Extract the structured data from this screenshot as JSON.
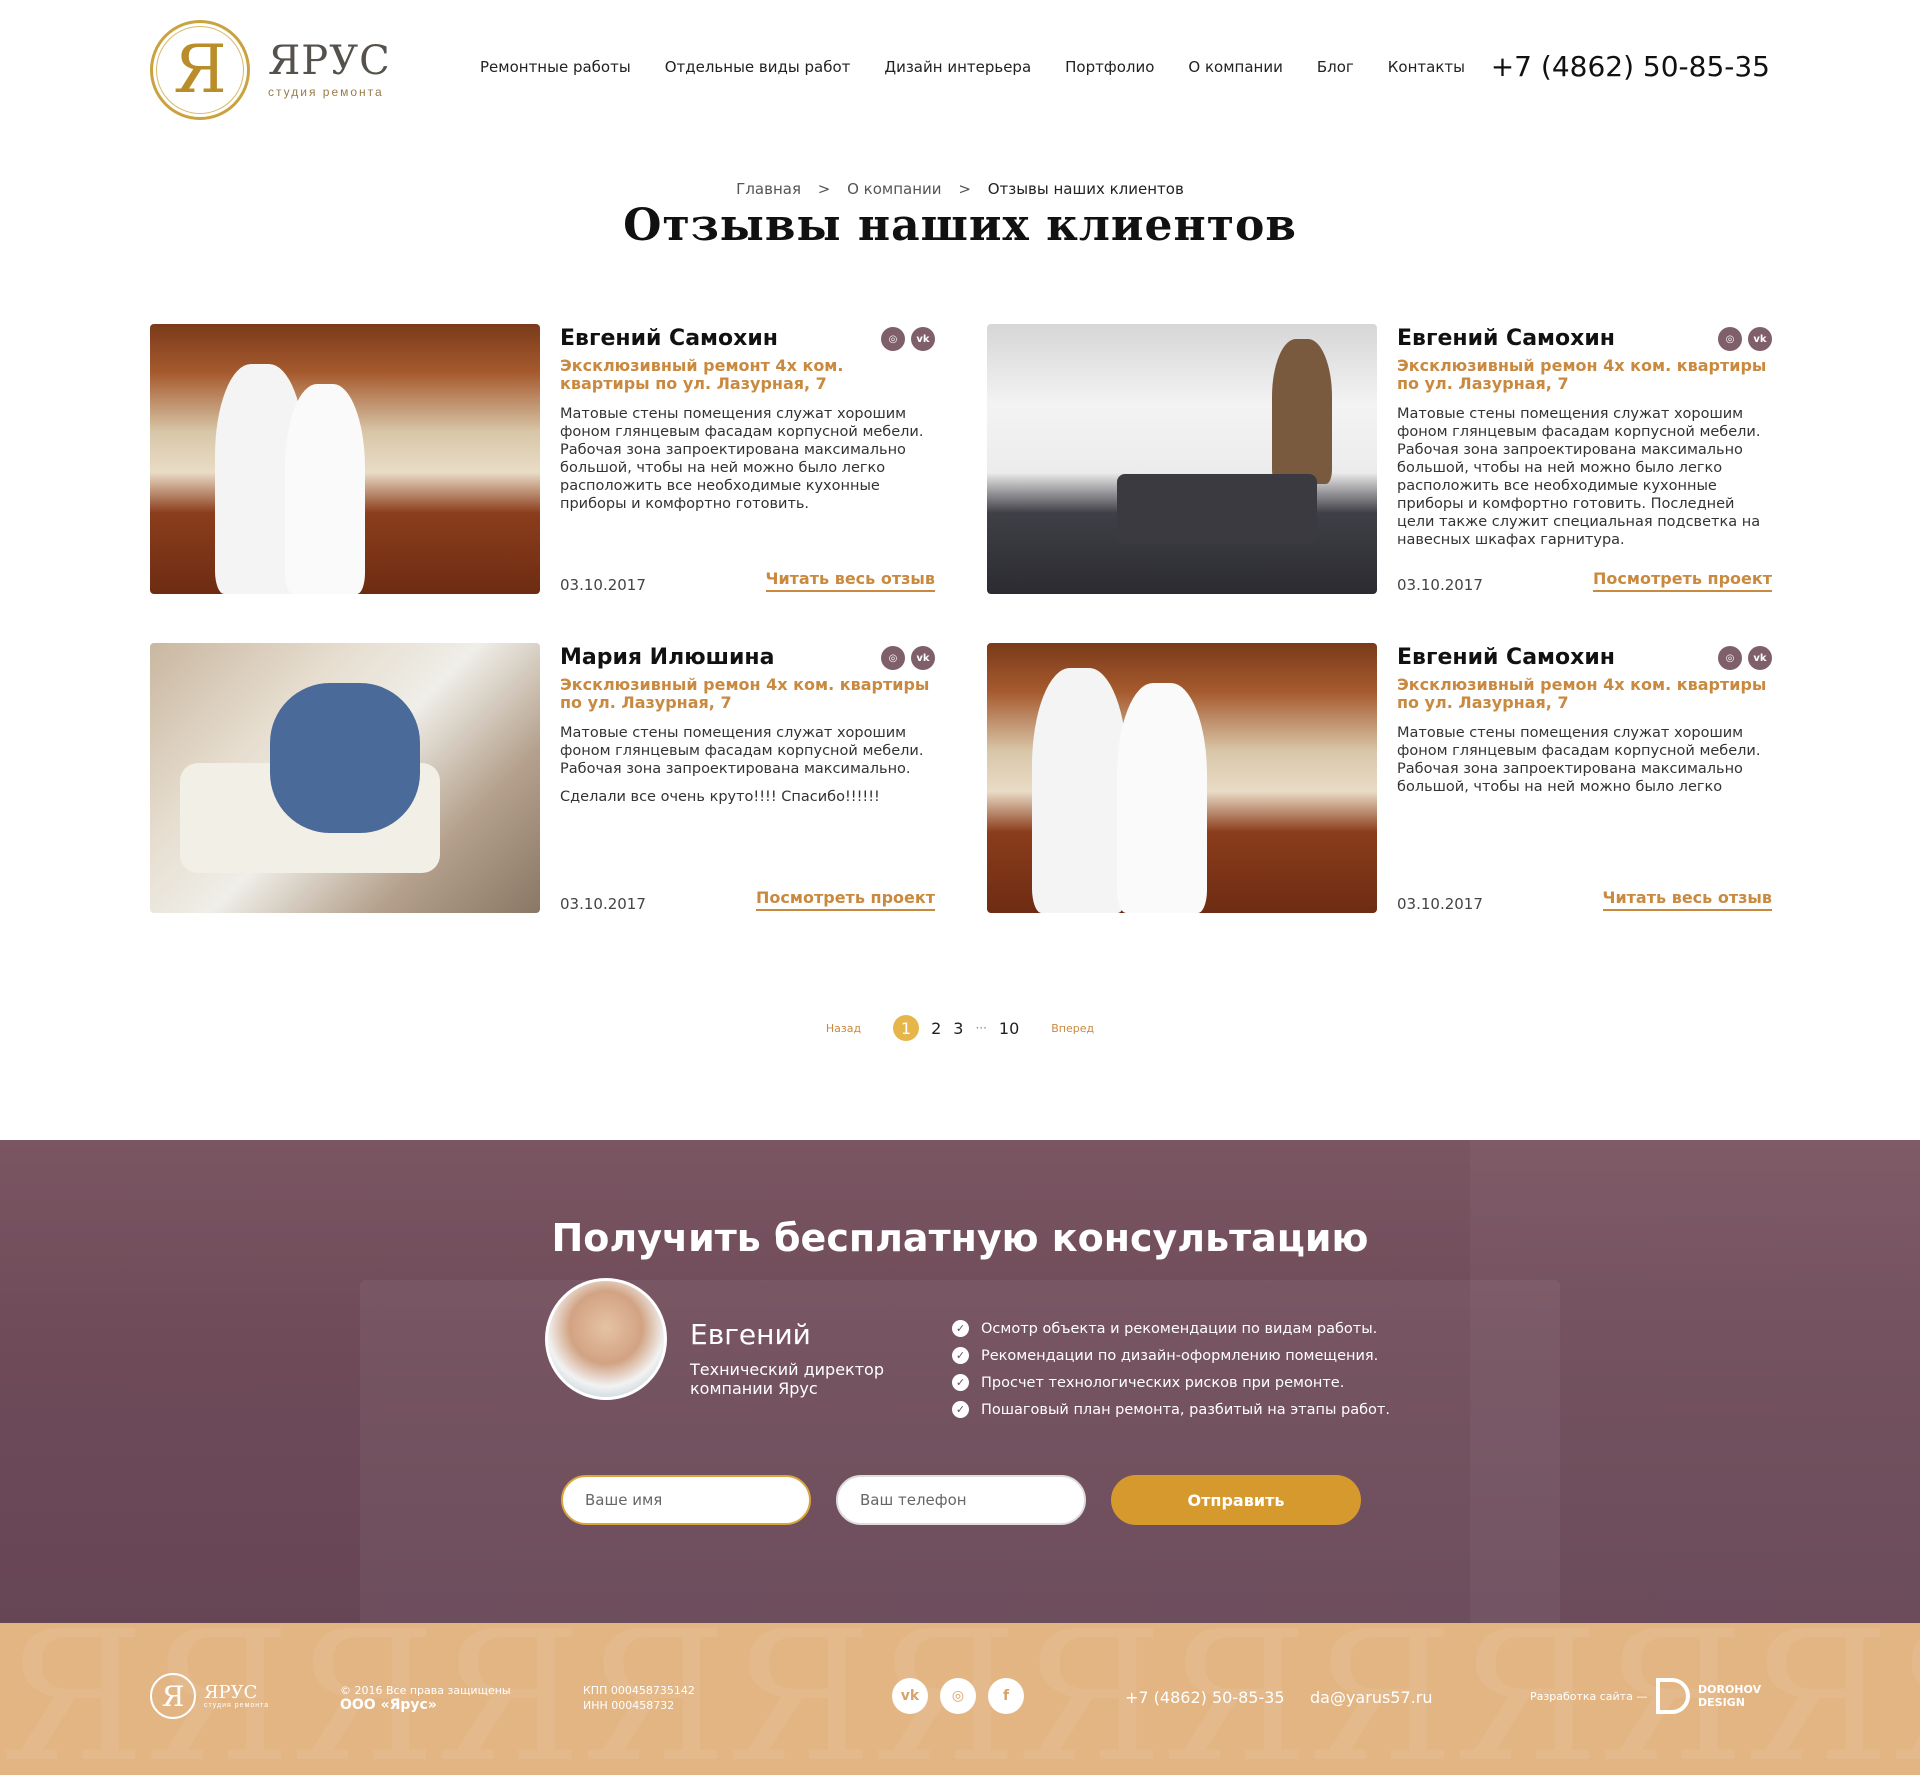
{
  "header": {
    "logo_name": "ЯРУС",
    "logo_sub": "студия ремонта",
    "nav": [
      "Ремонтные работы",
      "Отдельные виды работ",
      "Дизайн интерьера",
      "Портфолио",
      "О компании",
      "Блог",
      "Контакты"
    ],
    "phone": "+7 (4862) 50-85-35"
  },
  "breadcrumb": {
    "items": [
      "Главная",
      "О компании",
      "Отзывы наших клиентов"
    ],
    "separator": ">"
  },
  "page_title": "Отзывы наших клиентов",
  "reviews": [
    {
      "name": "Евгений Самохин",
      "project": "Эксклюзивный ремонт 4х ком. квартиры по ул. Лазурная, 7",
      "text": "Матовые стены помещения служат хорошим фоном глянцевым фасадам корпусной мебели. Рабочая зона запроектирована максимально большой, чтобы на ней можно было легко расположить все необходимые кухонные приборы и комфортно готовить.",
      "extra": "",
      "date": "03.10.2017",
      "link": "Читать весь отзыв",
      "photo": "kitchen"
    },
    {
      "name": "Евгений Самохин",
      "project": "Эксклюзивный ремон 4х ком. квартиры по ул. Лазурная, 7",
      "text": "Матовые стены помещения служат хорошим фоном глянцевым фасадам корпусной мебели. Рабочая зона запроектирована максимально большой, чтобы на ней можно было легко расположить все необходимые кухонные приборы и комфортно готовить. Последней цели также служит специальная подсветка на навесных шкафах гарнитура.",
      "extra": "",
      "date": "03.10.2017",
      "link": "Посмотреть проект",
      "photo": "living"
    },
    {
      "name": "Мария Илюшина",
      "project": "Эксклюзивный ремон 4х ком. квартиры по ул. Лазурная, 7",
      "text": "Матовые стены помещения служат хорошим фоном глянцевым фасадам корпусной мебели. Рабочая зона запроектирована максимально.",
      "extra": "Сделали все очень круто!!!! Спасибо!!!!!!",
      "date": "03.10.2017",
      "link": "Посмотреть проект",
      "photo": "sofa"
    },
    {
      "name": "Евгений Самохин",
      "project": "Эксклюзивный ремон 4х ком. квартиры по ул. Лазурная, 7",
      "text": "Матовые стены помещения служат хорошим фоном глянцевым фасадам корпусной мебели. Рабочая зона запроектирована максимально большой, чтобы на ней можно было легко",
      "extra": "",
      "date": "03.10.2017",
      "link": "Читать весь отзыв",
      "photo": "kitchen"
    }
  ],
  "review_socials": [
    "instagram-icon",
    "vk-icon"
  ],
  "pagination": {
    "prev": "Назад",
    "next": "Вперед",
    "pages": [
      "1",
      "2",
      "3"
    ],
    "dots": "···",
    "last": "10",
    "current": "1"
  },
  "consult": {
    "title": "Получить бесплатную консультацию",
    "person_name": "Евгений",
    "person_role": "Технический директор компании Ярус",
    "checks": [
      "Осмотр объекта и рекомендации по видам работы.",
      "Рекомендации по дизайн-оформлению помещения.",
      "Просчет технологических рисков при ремонте.",
      "Пошаговый план ремонта, разбитый на этапы работ."
    ],
    "name_placeholder": "Ваше имя",
    "phone_placeholder": "Ваш телефон",
    "submit": "Отправить"
  },
  "footer": {
    "logo_name": "ЯРУС",
    "logo_sub": "студия ремонта",
    "copyright": "© 2016 Все права защищены",
    "company": "ООО «Ярус»",
    "kpp": "КПП 000458735142",
    "inn": "ИНН 000458732",
    "socials": [
      "vk-icon",
      "instagram-icon",
      "facebook-icon"
    ],
    "phone": "+7 (4862) 50-85-35",
    "email": "da@yarus57.ru",
    "dev_label": "Разработка сайта —",
    "dev_name_1": "DOROHOV",
    "dev_name_2": "DESIGN"
  },
  "colors": {
    "accent": "#c9893f",
    "gold": "#d6992d",
    "consult_bg": "#6f4b59",
    "footer_bg": "#e2b583"
  }
}
